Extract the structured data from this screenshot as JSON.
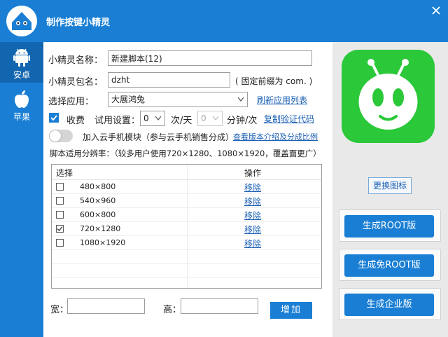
{
  "app": {
    "title": "制作按键小精灵"
  },
  "sidebar": {
    "items": [
      {
        "label": "安卓",
        "icon": "android-icon"
      },
      {
        "label": "苹果",
        "icon": "apple-icon"
      }
    ]
  },
  "form": {
    "name_label": "小精灵名称：",
    "name_value": "新建脚本(12)",
    "package_label": "小精灵包名：",
    "package_value": "dzht",
    "package_hint": "( 固定前缀为 com. )",
    "app_label": "选择应用：",
    "app_value": "大展鸿兔",
    "refresh_link": "刷新应用列表",
    "charge_label": "收费",
    "trial_label": "试用设置：",
    "trial_count": "0",
    "per_day": "次/天",
    "trial_minutes": "0",
    "per_minutes": "分钟/次",
    "copy_link": "复制验证代码",
    "cloud_label": "加入云手机模块（参与云手机销售分成）",
    "cloud_link": "查看版本介绍及分成比例",
    "resolution_title": "脚本适用分辨率：（较多用户使用720×1280、1080×1920，覆盖面更广）"
  },
  "table": {
    "headers": {
      "select": "选择",
      "action": "操作"
    },
    "rows": [
      {
        "resolution": "480×800",
        "checked": false,
        "action": "移除"
      },
      {
        "resolution": "540×960",
        "checked": false,
        "action": "移除"
      },
      {
        "resolution": "600×800",
        "checked": false,
        "action": "移除"
      },
      {
        "resolution": "720×1280",
        "checked": true,
        "action": "移除"
      },
      {
        "resolution": "1080×1920",
        "checked": false,
        "action": "移除"
      }
    ]
  },
  "size": {
    "width_label": "宽：",
    "height_label": "高：",
    "width_value": "",
    "height_value": "",
    "add_button": "增加"
  },
  "right": {
    "change_icon": "更换图标",
    "gen_root": "生成ROOT版",
    "gen_noroot": "生成免ROOT版",
    "gen_enterprise": "生成企业版"
  },
  "colors": {
    "primary": "#1a7fd4",
    "link": "#1a5fb4",
    "app_icon_green": "#2bc83a"
  }
}
